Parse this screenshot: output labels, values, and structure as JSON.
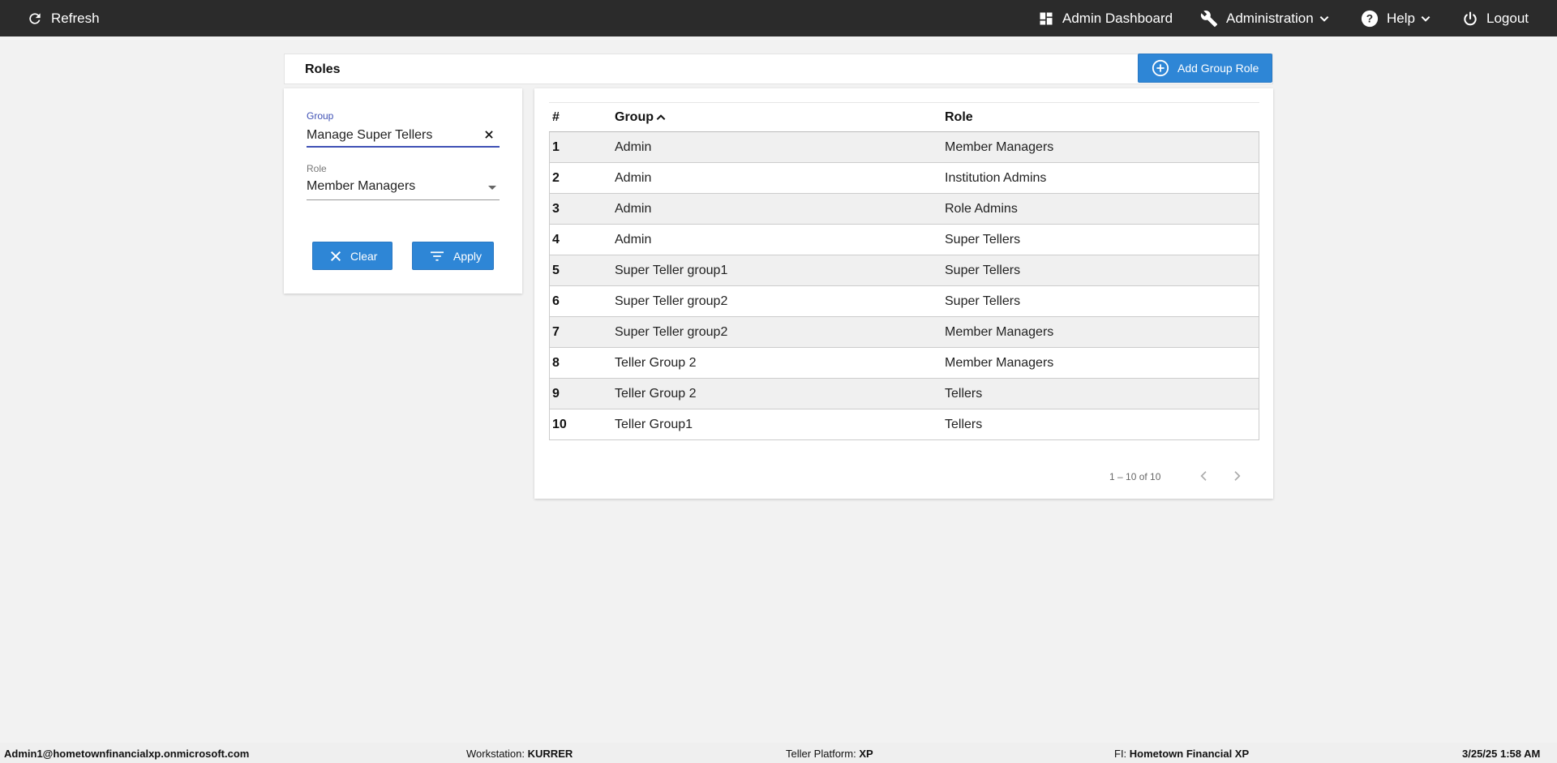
{
  "topbar": {
    "refresh_label": "Refresh",
    "dashboard_label": "Admin Dashboard",
    "administration_label": "Administration",
    "help_label": "Help",
    "logout_label": "Logout"
  },
  "page": {
    "title": "Roles",
    "add_button_label": "Add Group Role"
  },
  "filter": {
    "group_label": "Group",
    "group_value": "Manage Super Tellers",
    "role_label": "Role",
    "role_value": "Member Managers",
    "clear_label": "Clear",
    "apply_label": "Apply"
  },
  "table": {
    "columns": {
      "num": "#",
      "group": "Group",
      "role": "Role"
    },
    "sort": {
      "column": "Group",
      "direction": "ascending"
    },
    "rows": [
      {
        "num": "1",
        "group": "Admin",
        "role": "Member Managers"
      },
      {
        "num": "2",
        "group": "Admin",
        "role": "Institution Admins"
      },
      {
        "num": "3",
        "group": "Admin",
        "role": "Role Admins"
      },
      {
        "num": "4",
        "group": "Admin",
        "role": "Super Tellers"
      },
      {
        "num": "5",
        "group": "Super Teller group1",
        "role": "Super Tellers"
      },
      {
        "num": "6",
        "group": "Super Teller group2",
        "role": "Super Tellers"
      },
      {
        "num": "7",
        "group": "Super Teller group2",
        "role": "Member Managers"
      },
      {
        "num": "8",
        "group": "Teller Group 2",
        "role": "Member Managers"
      },
      {
        "num": "9",
        "group": "Teller Group 2",
        "role": "Tellers"
      },
      {
        "num": "10",
        "group": "Teller Group1",
        "role": "Tellers"
      }
    ],
    "pagination": "1 – 10 of 10"
  },
  "statusbar": {
    "user": "Admin1@hometownfinancialxp.onmicrosoft.com",
    "workstation_label": "Workstation:",
    "workstation_value": "KURRER",
    "platform_label": "Teller Platform:",
    "platform_value": "XP",
    "fi_label": "FI:",
    "fi_value": "Hometown Financial XP",
    "datetime": "3/25/25 1:58 AM"
  },
  "colors": {
    "topbar_bg": "#2b2b2b",
    "accent_blue": "#2e86d6",
    "input_focus": "#3f51b5",
    "page_bg": "#f2f2f2"
  },
  "icons": [
    "refresh-icon",
    "dashboard-icon",
    "wrench-icon",
    "help-icon",
    "power-icon",
    "chevron-down-icon",
    "add-circle-icon",
    "close-icon",
    "filter-icon",
    "sort-up-icon",
    "chevron-left-icon",
    "chevron-right-icon"
  ]
}
